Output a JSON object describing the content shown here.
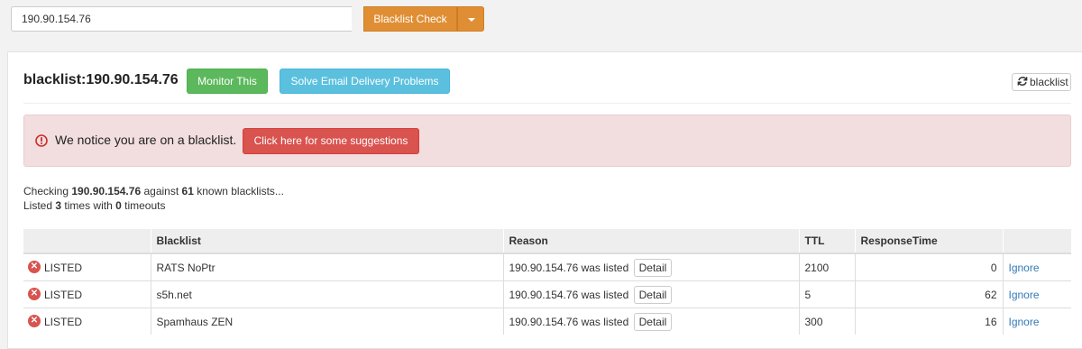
{
  "search": {
    "value": "190.90.154.76"
  },
  "toolbar": {
    "check_label": "Blacklist Check",
    "caret_icon": "chevron-down-icon"
  },
  "panel": {
    "heading": "blacklist:190.90.154.76",
    "monitor_label": "Monitor This",
    "solve_label": "Solve Email Delivery Problems",
    "refresh_label": "blacklist",
    "refresh_icon": "refresh-icon"
  },
  "alert": {
    "text": "We notice you are on a blacklist.",
    "button_label": "Click here for some suggestions",
    "icon": "exclamation-circle-icon",
    "color": "#d9534f"
  },
  "summary": {
    "checking_prefix": "Checking",
    "ip": "190.90.154.76",
    "against": "against",
    "count": "61",
    "known_suffix": "known blacklists...",
    "listed_prefix": "Listed",
    "listed_count": "3",
    "times_with": "times with",
    "timeouts_count": "0",
    "timeouts_suffix": "timeouts"
  },
  "table": {
    "headers": [
      "",
      "Blacklist",
      "Reason",
      "TTL",
      "ResponseTime",
      ""
    ],
    "detail_label": "Detail",
    "ignore_label": "Ignore",
    "rows": [
      {
        "status": "LISTED",
        "blacklist": "RATS NoPtr",
        "reason": "190.90.154.76 was listed",
        "ttl": "2100",
        "response": "0"
      },
      {
        "status": "LISTED",
        "blacklist": "s5h.net",
        "reason": "190.90.154.76 was listed",
        "ttl": "5",
        "response": "62"
      },
      {
        "status": "LISTED",
        "blacklist": "Spamhaus ZEN",
        "reason": "190.90.154.76 was listed",
        "ttl": "300",
        "response": "16"
      }
    ]
  }
}
